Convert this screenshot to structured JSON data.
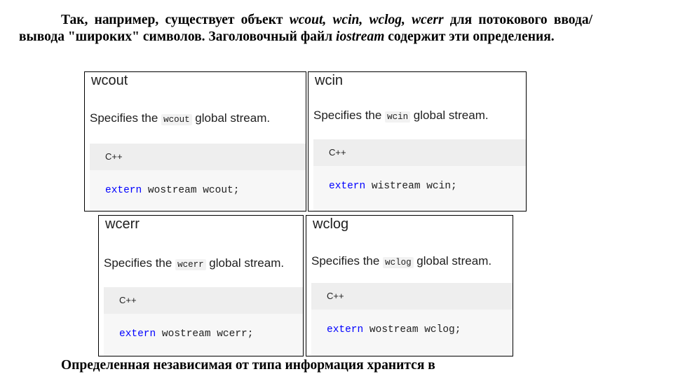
{
  "intro": {
    "t1": "Так, например, существует объект ",
    "objs": "wcout, wcin, wclog, wcerr",
    "t2": " для потокового ввода/вывода \"широких\" символов. Заголовочный файл ",
    "header": "iostream",
    "t3": " содержит эти определения."
  },
  "boxes": {
    "wcout": {
      "title": "wcout",
      "desc_pre": "Specifies the ",
      "code": "wcout",
      "desc_post": " global stream.",
      "lang": "C++",
      "keyword": "extern",
      "decl": " wostream wcout;"
    },
    "wcin": {
      "title": "wcin",
      "desc_pre": "Specifies the ",
      "code": "wcin",
      "desc_post": " global stream.",
      "lang": "C++",
      "keyword": "extern",
      "decl": " wistream wcin;"
    },
    "wcerr": {
      "title": "wcerr",
      "desc_pre": "Specifies the ",
      "code": "wcerr",
      "desc_post": " global stream.",
      "lang": "C++",
      "keyword": "extern",
      "decl": " wostream wcerr;"
    },
    "wclog": {
      "title": "wclog",
      "desc_pre": "Specifies the ",
      "code": "wclog",
      "desc_post": " global stream.",
      "lang": "C++",
      "keyword": "extern",
      "decl": " wostream wclog;"
    }
  },
  "next_paragraph": "Определенная независимая от типа информация хранится в"
}
